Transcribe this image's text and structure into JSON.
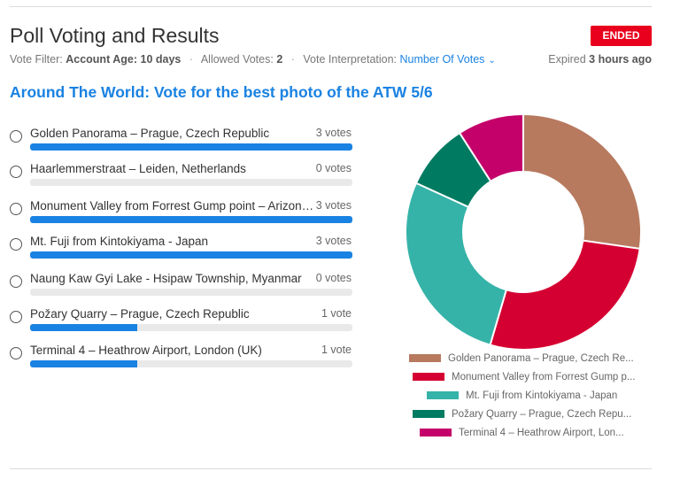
{
  "header": {
    "title": "Poll Voting and Results",
    "status_badge": "ENDED"
  },
  "meta": {
    "filter_label": "Vote Filter:",
    "filter_value": "Account Age: 10 days",
    "allowed_label": "Allowed Votes:",
    "allowed_value": "2",
    "interp_label": "Vote Interpretation:",
    "interp_value": "Number Of Votes",
    "expired_prefix": "Expired",
    "expired_value": "3 hours ago"
  },
  "poll": {
    "question": "Around The World: Vote for the best photo of the ATW 5/6",
    "options": [
      {
        "label": "Golden Panorama – Prague, Czech Republic",
        "votes_text": "3 votes",
        "share": 1.0
      },
      {
        "label": "Haarlemmerstraat – Leiden, Netherlands",
        "votes_text": "0 votes",
        "share": 0.0
      },
      {
        "label": "Monument Valley from Forrest Gump point – Arizona, USA",
        "votes_text": "3 votes",
        "share": 1.0
      },
      {
        "label": "Mt. Fuji from Kintokiyama - Japan",
        "votes_text": "3 votes",
        "share": 1.0
      },
      {
        "label": "Naung Kaw Gyi Lake - Hsipaw Township, Myanmar",
        "votes_text": "0 votes",
        "share": 0.0
      },
      {
        "label": "Požary Quarry – Prague, Czech Republic",
        "votes_text": "1 vote",
        "share": 0.333
      },
      {
        "label": "Terminal 4 – Heathrow Airport, London (UK)",
        "votes_text": "1 vote",
        "share": 0.333
      }
    ]
  },
  "chart_data": {
    "type": "pie",
    "donut": true,
    "categories": [
      "Golden Panorama – Prague, Czech Re...",
      "Monument Valley from Forrest Gump p...",
      "Mt. Fuji from Kintokiyama - Japan",
      "Požary Quarry – Prague, Czech Repu...",
      "Terminal 4 – Heathrow Airport, Lon..."
    ],
    "values": [
      3,
      3,
      3,
      1,
      1
    ],
    "colors": [
      "#b77a5f",
      "#d50032",
      "#36b3a8",
      "#007b62",
      "#c4006a"
    ],
    "legend_placement": "bottom"
  }
}
